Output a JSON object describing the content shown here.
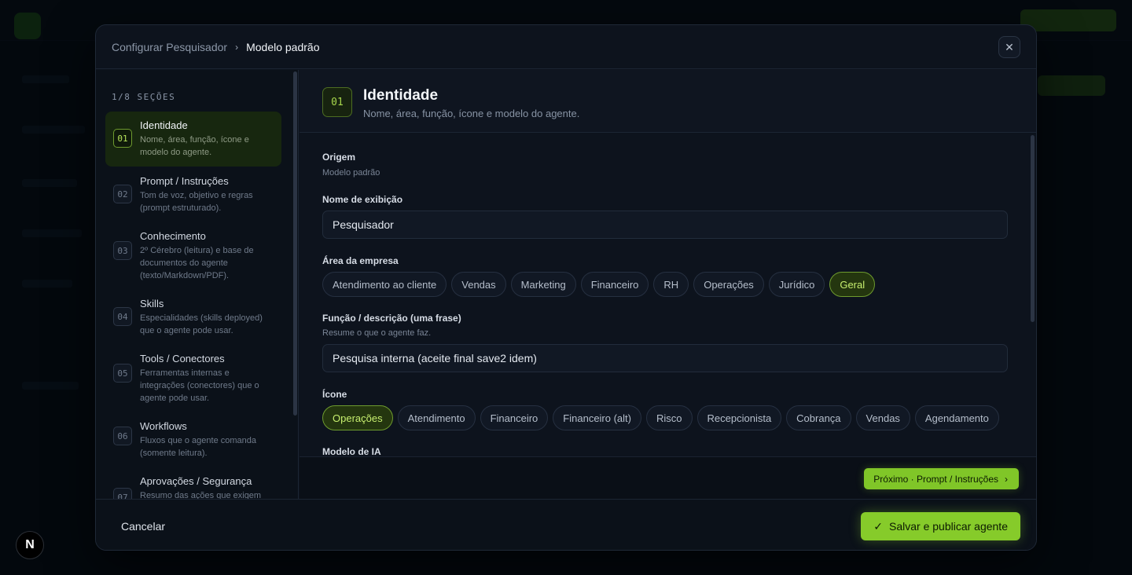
{
  "breadcrumb": {
    "parent": "Configurar Pesquisador",
    "current": "Modelo padrão"
  },
  "close_icon": "close-icon",
  "sidebar": {
    "section_count": "1/8 SEÇÕES",
    "items": [
      {
        "num": "01",
        "title": "Identidade",
        "desc": "Nome, área, função, ícone e modelo do agente."
      },
      {
        "num": "02",
        "title": "Prompt / Instruções",
        "desc": "Tom de voz, objetivo e regras (prompt estruturado)."
      },
      {
        "num": "03",
        "title": "Conhecimento",
        "desc": "2º Cérebro (leitura) e base de documentos do agente (texto/Markdown/PDF)."
      },
      {
        "num": "04",
        "title": "Skills",
        "desc": "Especialidades (skills deployed) que o agente pode usar."
      },
      {
        "num": "05",
        "title": "Tools / Conectores",
        "desc": "Ferramentas internas e integrações (conectores) que o agente pode usar."
      },
      {
        "num": "06",
        "title": "Workflows",
        "desc": "Fluxos que o agente comanda (somente leitura)."
      },
      {
        "num": "07",
        "title": "Aprovações / Segurança",
        "desc": "Resumo das ações que exigem"
      }
    ]
  },
  "section": {
    "num": "01",
    "title": "Identidade",
    "desc": "Nome, área, função, ícone e modelo do agente."
  },
  "form": {
    "origin_label": "Origem",
    "origin_value": "Modelo padrão",
    "name_label": "Nome de exibição",
    "name_value": "Pesquisador",
    "area_label": "Área da empresa",
    "areas": [
      "Atendimento ao cliente",
      "Vendas",
      "Marketing",
      "Financeiro",
      "RH",
      "Operações",
      "Jurídico",
      "Geral"
    ],
    "area_selected": "Geral",
    "role_label": "Função / descrição (uma frase)",
    "role_hint": "Resume o que o agente faz.",
    "role_value": "Pesquisa interna (aceite final save2 idem)",
    "icon_label": "Ícone",
    "icons": [
      "Operações",
      "Atendimento",
      "Financeiro",
      "Financeiro (alt)",
      "Risco",
      "Recepcionista",
      "Cobrança",
      "Vendas",
      "Agendamento"
    ],
    "icon_selected": "Operações",
    "model_label": "Modelo de IA"
  },
  "actions": {
    "next_label": "Próximo · Prompt / Instruções",
    "cancel_label": "Cancelar",
    "save_label": "Salvar e publicar agente"
  },
  "next_js_badge": "N",
  "colors": {
    "accent": "#86cb2a",
    "selected_chip_text": "#c7ef6f",
    "background": "#0d131d"
  }
}
